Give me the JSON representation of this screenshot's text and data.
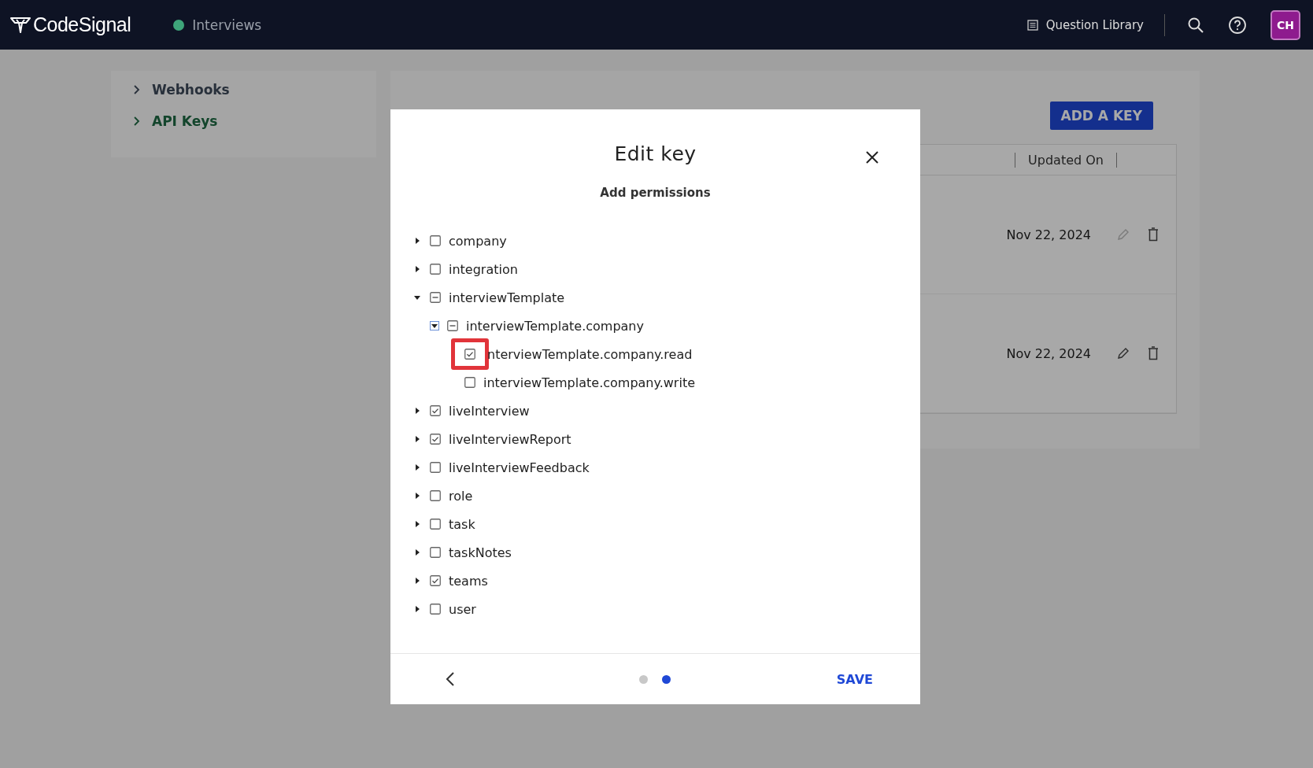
{
  "topbar": {
    "logo": "CodeSignal",
    "product": "Interviews",
    "question_library": "Question Library",
    "avatar": "CH"
  },
  "sidebar": {
    "items": [
      {
        "label": "Webhooks",
        "selected": false
      },
      {
        "label": "API Keys",
        "selected": true
      }
    ]
  },
  "main": {
    "add_button": "ADD A KEY",
    "table": {
      "columns": [
        "Updated On"
      ],
      "rows": [
        {
          "updated_on": "Nov 22, 2024",
          "edit_disabled": true
        },
        {
          "updated_on": "Nov 22, 2024",
          "edit_disabled": false
        }
      ]
    }
  },
  "dialog": {
    "title": "Edit key",
    "subtitle": "Add permissions",
    "tree": [
      {
        "label": "company",
        "expanded": false,
        "checked": false,
        "indeterminate": false
      },
      {
        "label": "integration",
        "expanded": false,
        "checked": false,
        "indeterminate": false
      },
      {
        "label": "interviewTemplate",
        "expanded": true,
        "checked": false,
        "indeterminate": true,
        "children": [
          {
            "label": "interviewTemplate.company",
            "expanded": true,
            "checked": false,
            "indeterminate": true,
            "children": [
              {
                "label": "nterviewTemplate.company.read",
                "checked": true,
                "indeterminate": false,
                "highlighted": true
              },
              {
                "label": "interviewTemplate.company.write",
                "checked": false,
                "indeterminate": false,
                "highlighted": false
              }
            ]
          }
        ]
      },
      {
        "label": "liveInterview",
        "expanded": false,
        "checked": true,
        "indeterminate": false
      },
      {
        "label": "liveInterviewReport",
        "expanded": false,
        "checked": true,
        "indeterminate": false
      },
      {
        "label": "liveInterviewFeedback",
        "expanded": false,
        "checked": false,
        "indeterminate": false
      },
      {
        "label": "role",
        "expanded": false,
        "checked": false,
        "indeterminate": false
      },
      {
        "label": "task",
        "expanded": false,
        "checked": false,
        "indeterminate": false
      },
      {
        "label": "taskNotes",
        "expanded": false,
        "checked": false,
        "indeterminate": false
      },
      {
        "label": "teams",
        "expanded": false,
        "checked": true,
        "indeterminate": false
      },
      {
        "label": "user",
        "expanded": false,
        "checked": false,
        "indeterminate": false
      }
    ],
    "pages": [
      {
        "selected": false
      },
      {
        "selected": true
      }
    ],
    "save": "SAVE"
  }
}
